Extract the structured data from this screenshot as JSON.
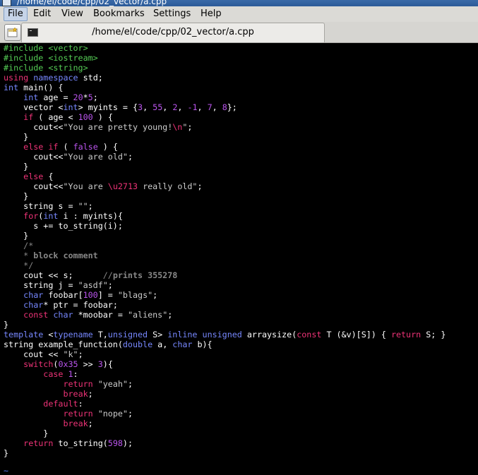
{
  "window": {
    "title": "/home/el/code/cpp/02_vector/a.cpp"
  },
  "menubar": {
    "items": [
      "File",
      "Edit",
      "View",
      "Bookmarks",
      "Settings",
      "Help"
    ]
  },
  "tab": {
    "title": "/home/el/code/cpp/02_vector/a.cpp"
  },
  "icons": {
    "new_tab": "new-tab-icon",
    "terminal": "terminal-icon"
  },
  "colors": {
    "preprocessor": "#55cc55",
    "keyword": "#ee3377",
    "type": "#7788ff",
    "number": "#bb55ee",
    "comment": "#888888",
    "background": "#000000",
    "text": "#ffffff"
  },
  "editor": {
    "end_marker": "~",
    "lines": [
      [
        [
          "p",
          "#include <vector>"
        ]
      ],
      [
        [
          "p",
          "#include <iostream>"
        ]
      ],
      [
        [
          "p",
          "#include <string>"
        ]
      ],
      [
        [
          "k",
          "using"
        ],
        [
          "x",
          " "
        ],
        [
          "t",
          "namespace"
        ],
        [
          "x",
          " std;"
        ]
      ],
      [
        [
          "t",
          "int"
        ],
        [
          "x",
          " main() {"
        ]
      ],
      [
        [
          "x",
          "    "
        ],
        [
          "t",
          "int"
        ],
        [
          "x",
          " age = "
        ],
        [
          "n",
          "20"
        ],
        [
          "x",
          "*"
        ],
        [
          "n",
          "5"
        ],
        [
          "x",
          ";"
        ]
      ],
      [
        [
          "x",
          "    vector <"
        ],
        [
          "t",
          "int"
        ],
        [
          "x",
          "> myints = {"
        ],
        [
          "n",
          "3"
        ],
        [
          "x",
          ", "
        ],
        [
          "n",
          "55"
        ],
        [
          "x",
          ", "
        ],
        [
          "n",
          "2"
        ],
        [
          "x",
          ", "
        ],
        [
          "n",
          "-1"
        ],
        [
          "x",
          ", "
        ],
        [
          "n",
          "7"
        ],
        [
          "x",
          ", "
        ],
        [
          "n",
          "8"
        ],
        [
          "x",
          "};"
        ]
      ],
      [
        [
          "x",
          "    "
        ],
        [
          "k",
          "if"
        ],
        [
          "x",
          " ( age < "
        ],
        [
          "n",
          "100"
        ],
        [
          "x",
          " ) {"
        ]
      ],
      [
        [
          "x",
          "      cout<<"
        ],
        [
          "s",
          "\"You are pretty young!"
        ],
        [
          "e",
          "\\n"
        ],
        [
          "s",
          "\""
        ],
        [
          "x",
          ";"
        ]
      ],
      [
        [
          "x",
          "    }"
        ]
      ],
      [
        [
          "x",
          "    "
        ],
        [
          "k",
          "else"
        ],
        [
          "x",
          " "
        ],
        [
          "k",
          "if"
        ],
        [
          "x",
          " ( "
        ],
        [
          "n",
          "false"
        ],
        [
          "x",
          " ) {"
        ]
      ],
      [
        [
          "x",
          "      cout<<"
        ],
        [
          "s",
          "\"You are old\""
        ],
        [
          "x",
          ";"
        ]
      ],
      [
        [
          "x",
          "    }"
        ]
      ],
      [
        [
          "x",
          "    "
        ],
        [
          "k",
          "else"
        ],
        [
          "x",
          " {"
        ]
      ],
      [
        [
          "x",
          "      cout<<"
        ],
        [
          "s",
          "\"You are "
        ],
        [
          "e",
          "\\u2713"
        ],
        [
          "s",
          " really old\""
        ],
        [
          "x",
          ";"
        ]
      ],
      [
        [
          "x",
          "    }"
        ]
      ],
      [
        [
          "x",
          "    string s = "
        ],
        [
          "s",
          "\"\""
        ],
        [
          "x",
          ";"
        ]
      ],
      [
        [
          "x",
          "    "
        ],
        [
          "k",
          "for"
        ],
        [
          "x",
          "("
        ],
        [
          "t",
          "int"
        ],
        [
          "x",
          " i : myints){"
        ]
      ],
      [
        [
          "x",
          "      s += to_string(i);"
        ]
      ],
      [
        [
          "x",
          "    }"
        ]
      ],
      [
        [
          "x",
          "    "
        ],
        [
          "c",
          "/*"
        ]
      ],
      [
        [
          "x",
          "    "
        ],
        [
          "c",
          "* "
        ],
        [
          "cb",
          "block comment"
        ]
      ],
      [
        [
          "x",
          "    "
        ],
        [
          "c",
          "*/"
        ]
      ],
      [
        [
          "x",
          "    cout << s;      "
        ],
        [
          "c",
          "//"
        ],
        [
          "cb",
          "prints 355278"
        ]
      ],
      [
        [
          "x",
          "    string j = "
        ],
        [
          "s",
          "\"asdf\""
        ],
        [
          "x",
          ";"
        ]
      ],
      [
        [
          "x",
          "    "
        ],
        [
          "t",
          "char"
        ],
        [
          "x",
          " foobar["
        ],
        [
          "n",
          "100"
        ],
        [
          "x",
          "] = "
        ],
        [
          "s",
          "\"blags\""
        ],
        [
          "x",
          ";"
        ]
      ],
      [
        [
          "x",
          "    "
        ],
        [
          "t",
          "char"
        ],
        [
          "x",
          "* ptr = foobar;"
        ]
      ],
      [
        [
          "x",
          "    "
        ],
        [
          "k",
          "const"
        ],
        [
          "x",
          " "
        ],
        [
          "t",
          "char"
        ],
        [
          "x",
          " *moobar = "
        ],
        [
          "s",
          "\"aliens\""
        ],
        [
          "x",
          ";"
        ]
      ],
      [
        [
          "x",
          "}"
        ]
      ],
      [
        [
          "t",
          "template"
        ],
        [
          "x",
          " <"
        ],
        [
          "t",
          "typename"
        ],
        [
          "x",
          " T,"
        ],
        [
          "t",
          "unsigned"
        ],
        [
          "x",
          " S> "
        ],
        [
          "t",
          "inline"
        ],
        [
          "x",
          " "
        ],
        [
          "t",
          "unsigned"
        ],
        [
          "x",
          " arraysize("
        ],
        [
          "k",
          "const"
        ],
        [
          "x",
          " T (&v)[S]) { "
        ],
        [
          "k",
          "return"
        ],
        [
          "x",
          " S; }"
        ]
      ],
      [
        [
          "x",
          "string example_function("
        ],
        [
          "t",
          "double"
        ],
        [
          "x",
          " a, "
        ],
        [
          "t",
          "char"
        ],
        [
          "x",
          " b){"
        ]
      ],
      [
        [
          "x",
          "    cout << "
        ],
        [
          "s",
          "\"k\""
        ],
        [
          "x",
          ";"
        ]
      ],
      [
        [
          "x",
          "    "
        ],
        [
          "k",
          "switch"
        ],
        [
          "x",
          "("
        ],
        [
          "n",
          "0x35"
        ],
        [
          "x",
          " >> "
        ],
        [
          "n",
          "3"
        ],
        [
          "x",
          "){"
        ]
      ],
      [
        [
          "x",
          "        "
        ],
        [
          "k",
          "case"
        ],
        [
          "x",
          " "
        ],
        [
          "n",
          "1"
        ],
        [
          "x",
          ":"
        ]
      ],
      [
        [
          "x",
          "            "
        ],
        [
          "k",
          "return"
        ],
        [
          "x",
          " "
        ],
        [
          "s",
          "\"yeah\""
        ],
        [
          "x",
          ";"
        ]
      ],
      [
        [
          "x",
          "            "
        ],
        [
          "k",
          "break"
        ],
        [
          "x",
          ";"
        ]
      ],
      [
        [
          "x",
          "        "
        ],
        [
          "k",
          "default"
        ],
        [
          "x",
          ":"
        ]
      ],
      [
        [
          "x",
          "            "
        ],
        [
          "k",
          "return"
        ],
        [
          "x",
          " "
        ],
        [
          "s",
          "\"nope\""
        ],
        [
          "x",
          ";"
        ]
      ],
      [
        [
          "x",
          "            "
        ],
        [
          "k",
          "break"
        ],
        [
          "x",
          ";"
        ]
      ],
      [
        [
          "x",
          "        }"
        ]
      ],
      [
        [
          "x",
          "    "
        ],
        [
          "k",
          "return"
        ],
        [
          "x",
          " to_string("
        ],
        [
          "n",
          "598"
        ],
        [
          "x",
          ");"
        ]
      ],
      [
        [
          "x",
          "}"
        ]
      ]
    ]
  }
}
